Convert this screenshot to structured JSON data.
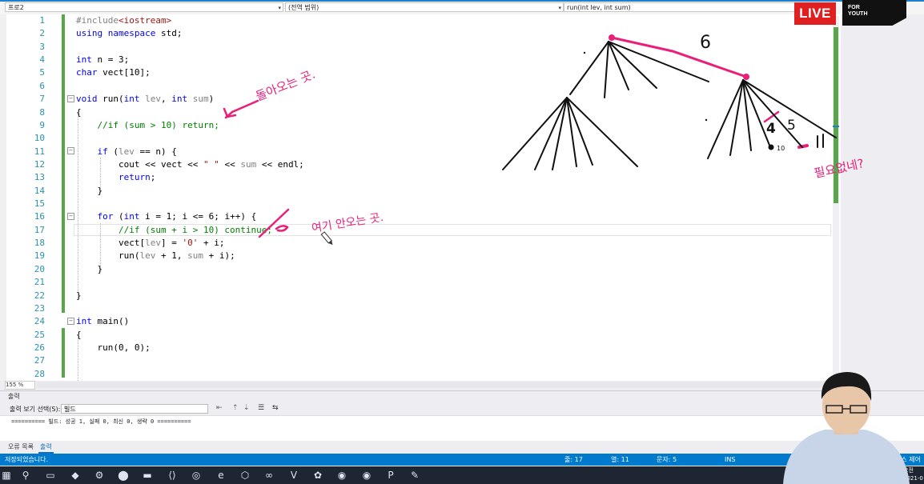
{
  "navbar": {
    "project_dropdown": "프로2",
    "scope_dropdown": "(전역 범위)",
    "function_dropdown": "run(int lev, int sum)"
  },
  "editor": {
    "zoom": "155 %",
    "line_numbers": [
      "1",
      "2",
      "3",
      "4",
      "5",
      "6",
      "7",
      "8",
      "9",
      "10",
      "11",
      "12",
      "13",
      "14",
      "15",
      "16",
      "17",
      "18",
      "19",
      "20",
      "21",
      "22",
      "23",
      "24",
      "25",
      "26",
      "27",
      "28"
    ],
    "lines": [
      {
        "indent": "",
        "segments": [
          {
            "t": "pp",
            "v": "#include"
          },
          {
            "t": "inc",
            "v": "<iostream>"
          }
        ]
      },
      {
        "indent": "",
        "segments": [
          {
            "t": "kw",
            "v": "using namespace"
          },
          {
            "t": "n",
            "v": " std;"
          }
        ]
      },
      {
        "indent": "",
        "segments": []
      },
      {
        "indent": "",
        "segments": [
          {
            "t": "kw",
            "v": "int"
          },
          {
            "t": "n",
            "v": " n = 3;"
          }
        ]
      },
      {
        "indent": "",
        "segments": [
          {
            "t": "kw",
            "v": "char"
          },
          {
            "t": "n",
            "v": " vect[10];"
          }
        ]
      },
      {
        "indent": "",
        "segments": []
      },
      {
        "indent": "",
        "segments": [
          {
            "t": "kw",
            "v": "void"
          },
          {
            "t": "n",
            "v": " run("
          },
          {
            "t": "kw",
            "v": "int"
          },
          {
            "t": "gr",
            "v": " lev"
          },
          {
            "t": "n",
            "v": ", "
          },
          {
            "t": "kw",
            "v": "int"
          },
          {
            "t": "gr",
            "v": " sum"
          },
          {
            "t": "n",
            "v": ")"
          }
        ]
      },
      {
        "indent": "",
        "segments": [
          {
            "t": "n",
            "v": "{"
          }
        ]
      },
      {
        "indent": "    ",
        "segments": [
          {
            "t": "cm",
            "v": "//if (sum > 10) return;"
          }
        ]
      },
      {
        "indent": "",
        "segments": []
      },
      {
        "indent": "    ",
        "segments": [
          {
            "t": "kw",
            "v": "if"
          },
          {
            "t": "n",
            "v": " ("
          },
          {
            "t": "gr",
            "v": "lev"
          },
          {
            "t": "n",
            "v": " == n) {"
          }
        ]
      },
      {
        "indent": "        ",
        "segments": [
          {
            "t": "n",
            "v": "cout << vect << "
          },
          {
            "t": "str",
            "v": "\" \""
          },
          {
            "t": "n",
            "v": " << "
          },
          {
            "t": "gr",
            "v": "sum"
          },
          {
            "t": "n",
            "v": " << endl;"
          }
        ]
      },
      {
        "indent": "        ",
        "segments": [
          {
            "t": "kw",
            "v": "return"
          },
          {
            "t": "n",
            "v": ";"
          }
        ]
      },
      {
        "indent": "    ",
        "segments": [
          {
            "t": "n",
            "v": "}"
          }
        ]
      },
      {
        "indent": "",
        "segments": []
      },
      {
        "indent": "    ",
        "segments": [
          {
            "t": "kw",
            "v": "for"
          },
          {
            "t": "n",
            "v": " ("
          },
          {
            "t": "kw",
            "v": "int"
          },
          {
            "t": "n",
            "v": " i = 1; i <= 6; i++) {"
          }
        ]
      },
      {
        "indent": "        ",
        "segments": [
          {
            "t": "cm",
            "v": "//if (sum + i > 10) continue;"
          }
        ]
      },
      {
        "indent": "        ",
        "segments": [
          {
            "t": "n",
            "v": "vect["
          },
          {
            "t": "gr",
            "v": "lev"
          },
          {
            "t": "n",
            "v": "] = "
          },
          {
            "t": "str",
            "v": "'0'"
          },
          {
            "t": "n",
            "v": " + i;"
          }
        ]
      },
      {
        "indent": "        ",
        "segments": [
          {
            "t": "n",
            "v": "run("
          },
          {
            "t": "gr",
            "v": "lev"
          },
          {
            "t": "n",
            "v": " + 1, "
          },
          {
            "t": "gr",
            "v": "sum"
          },
          {
            "t": "n",
            "v": " + i);"
          }
        ]
      },
      {
        "indent": "    ",
        "segments": [
          {
            "t": "n",
            "v": "}"
          }
        ]
      },
      {
        "indent": "",
        "segments": []
      },
      {
        "indent": "",
        "segments": [
          {
            "t": "n",
            "v": "}"
          }
        ]
      },
      {
        "indent": "",
        "segments": []
      },
      {
        "indent": "",
        "segments": [
          {
            "t": "kw",
            "v": "int"
          },
          {
            "t": "n",
            "v": " main()"
          }
        ]
      },
      {
        "indent": "",
        "segments": [
          {
            "t": "n",
            "v": "{"
          }
        ]
      },
      {
        "indent": "    ",
        "segments": [
          {
            "t": "n",
            "v": "run(0, 0);"
          }
        ]
      },
      {
        "indent": "",
        "segments": []
      },
      {
        "indent": "",
        "segments": []
      }
    ]
  },
  "annotations": {
    "note1": "돌아오는 곳.",
    "note2": "여기 안오는 곳.",
    "note3": "필요없네?",
    "num_6": "6",
    "num_4": "4",
    "num_5": "5",
    "num_11": "11",
    "num_10": "10"
  },
  "output_panel": {
    "title": "출력",
    "show_from_label": "출력 보기 선택(S):",
    "show_from_value": "빌드",
    "build_result": "========== 빌드: 성공 1, 실패 0, 최신 0, 생략 0 =========="
  },
  "bottom_tabs": [
    "오류 목록",
    "출력"
  ],
  "status_bar": {
    "message": "저장되었습니다.",
    "line": "줄: 17",
    "col": "열: 11",
    "char": "문자: 5",
    "mode": "INS",
    "right_text": "소스 제어에 추가"
  },
  "overlay": {
    "live_badge": "LIVE",
    "logo_lines": [
      "FOR",
      "YOUTH"
    ]
  },
  "taskbar": {
    "clock": "오전",
    "date": "2021-0"
  }
}
